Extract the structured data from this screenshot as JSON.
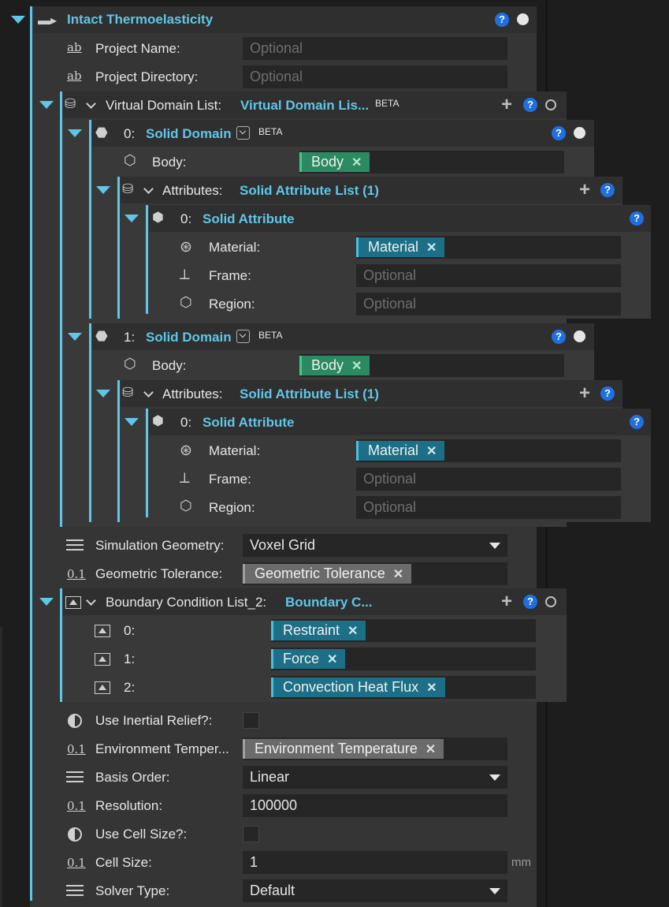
{
  "root": {
    "title": "Intact Thermoelasticity",
    "project_name": {
      "label": "Project Name:",
      "placeholder": "Optional"
    },
    "project_directory": {
      "label": "Project Directory:",
      "placeholder": "Optional"
    },
    "virtual_domain_list": {
      "label": "Virtual Domain List:",
      "value": "Virtual Domain Lis...",
      "badge": "BETA",
      "domains": [
        {
          "index": "0:",
          "title": "Solid Domain",
          "badge": "BETA",
          "body_label": "Body:",
          "body_chip": "Body",
          "attributes_label": "Attributes:",
          "attributes_value": "Solid Attribute List (1)",
          "attribute": {
            "index": "0:",
            "title": "Solid Attribute",
            "material_label": "Material:",
            "material_chip": "Material",
            "frame_label": "Frame:",
            "frame_placeholder": "Optional",
            "region_label": "Region:",
            "region_placeholder": "Optional"
          }
        },
        {
          "index": "1:",
          "title": "Solid Domain",
          "badge": "BETA",
          "body_label": "Body:",
          "body_chip": "Body",
          "attributes_label": "Attributes:",
          "attributes_value": "Solid Attribute List (1)",
          "attribute": {
            "index": "0:",
            "title": "Solid Attribute",
            "material_label": "Material:",
            "material_chip": "Material",
            "frame_label": "Frame:",
            "frame_placeholder": "Optional",
            "region_label": "Region:",
            "region_placeholder": "Optional"
          }
        }
      ]
    },
    "simulation_geometry": {
      "label": "Simulation Geometry:",
      "value": "Voxel Grid"
    },
    "geometric_tolerance": {
      "label": "Geometric Tolerance:",
      "chip": "Geometric Tolerance"
    },
    "boundary_condition_list": {
      "label": "Boundary Condition List_2:",
      "value": "Boundary C...",
      "items": [
        {
          "index": "0:",
          "chip": "Restraint"
        },
        {
          "index": "1:",
          "chip": "Force"
        },
        {
          "index": "2:",
          "chip": "Convection Heat Flux"
        }
      ]
    },
    "use_inertial_relief": {
      "label": "Use Inertial Relief?:"
    },
    "environment_temperature": {
      "label": "Environment Temper...",
      "chip": "Environment Temperature"
    },
    "basis_order": {
      "label": "Basis Order:",
      "value": "Linear"
    },
    "resolution": {
      "label": "Resolution:",
      "value": "100000"
    },
    "use_cell_size": {
      "label": "Use Cell Size?:"
    },
    "cell_size": {
      "label": "Cell Size:",
      "value": "1",
      "unit": "mm"
    },
    "solver_type": {
      "label": "Solver Type:",
      "value": "Default"
    }
  },
  "icons": {
    "text_field": "ab",
    "decimal_field": "0.1",
    "help": "?",
    "remove": "✕",
    "add": "+"
  },
  "colors": {
    "accent": "#5fc6e8",
    "help": "#1f6fe0",
    "chip_green": "#2c8a62",
    "chip_teal": "#1c6f86",
    "chip_gray": "#6b6b6b"
  }
}
